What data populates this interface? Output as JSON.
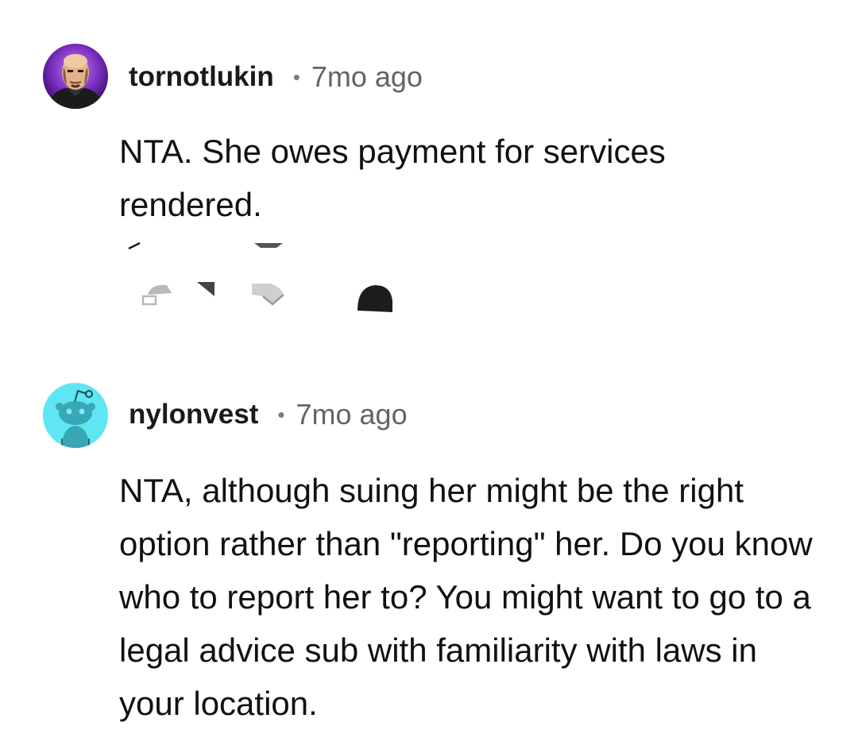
{
  "comments": [
    {
      "username": "tornotlukin",
      "separator": "•",
      "time": "7mo ago",
      "avatar_icon": "bald-man-avatar-icon",
      "body": "NTA. She owes payment for services rendered.",
      "actions": [
        "upvote-icon",
        "downvote-icon",
        "reply-icon",
        "award-icon"
      ]
    },
    {
      "username": "nylonvest",
      "separator": "•",
      "time": "7mo ago",
      "avatar_icon": "snoo-avatar-icon",
      "body": "NTA, although suing her might be the right option rather than \"reporting\" her. Do you know who to report her to? You might want to go to a legal advice sub with familiarity with laws in your location."
    }
  ],
  "colors": {
    "avatar1_bg": "#7b2fbf",
    "avatar2_bg": "#5ee6f5",
    "username": "#1a1a1b",
    "meta_gray": "#646464",
    "action_gray": "#9a9a9a",
    "award_dark": "#1c1c1c"
  }
}
